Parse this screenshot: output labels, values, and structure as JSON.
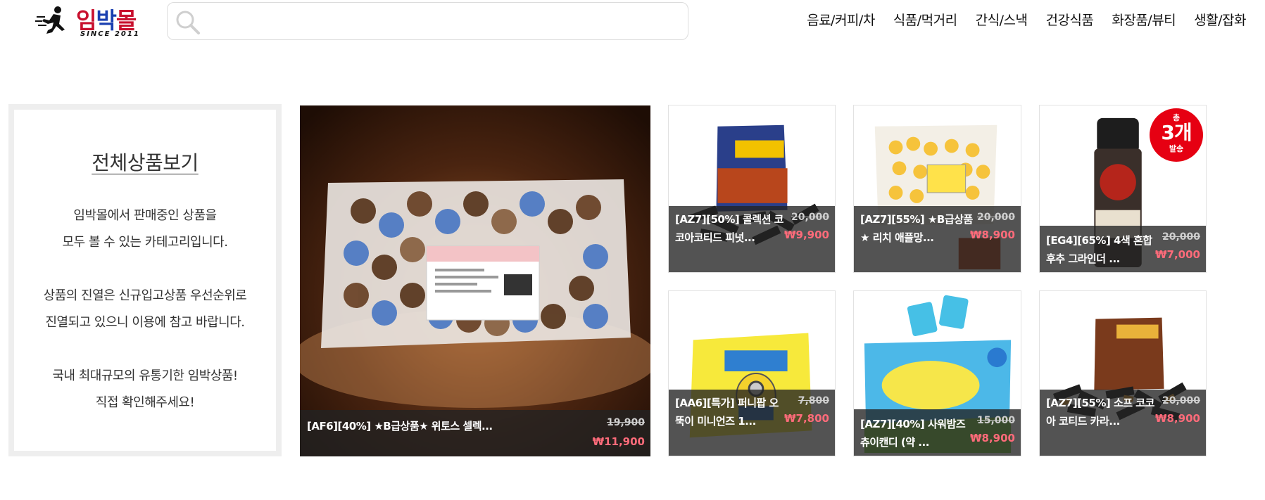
{
  "header": {
    "logo_text_a": "임",
    "logo_text_b": "박",
    "logo_text_c": "몰",
    "logo_since": "SINCE 2011",
    "search_placeholder": "",
    "nav": [
      "음료/커피/차",
      "식품/먹거리",
      "간식/스낵",
      "건강식품",
      "화장품/뷰티",
      "생활/잡화"
    ]
  },
  "info_box": {
    "title": "전체상품보기",
    "lines": [
      "임박몰에서 판매중인 상품을",
      "모두 볼 수 있는 카테고리입니다.",
      "상품의 진열은 신규입고상품 우선순위로",
      "진열되고 있으니 이용에 참고 바랍니다.",
      "국내 최대규모의 유통기한 임박상품!",
      "직접 확인해주세요!"
    ]
  },
  "products": [
    {
      "name": "[AF6][40%] ★B급상품★ 위토스 셀렉...",
      "original_price": "19,900",
      "sale_price": "₩11,900"
    },
    {
      "name": "[AZ7][50%] 콜렉션 코코아코티드 피넛...",
      "original_price": "20,000",
      "sale_price": "₩9,900"
    },
    {
      "name": "[AZ7][55%] ★B급상품★ 리치 애플망...",
      "original_price": "20,000",
      "sale_price": "₩8,900"
    },
    {
      "name": "[EG4][65%] 4색 혼합후추 그라인더 ...",
      "original_price": "20,000",
      "sale_price": "₩7,000",
      "badge": [
        "총",
        "3개",
        "발송"
      ]
    },
    {
      "name": "[AA6][특가] 퍼니팝 오뚝이 미니언즈 1...",
      "original_price": "7,800",
      "sale_price": "₩7,800"
    },
    {
      "name": "[AZ7][40%] 사워밤즈 츄이캔디 (약 ...",
      "original_price": "15,000",
      "sale_price": "₩8,900"
    },
    {
      "name": "[AZ7][55%] 소프 코코아 코티드 카라...",
      "original_price": "20,000",
      "sale_price": "₩8,900"
    }
  ],
  "colors": {
    "sale_price": "#ff6b7a",
    "badge": "#e60012",
    "overlay": "#232323"
  }
}
